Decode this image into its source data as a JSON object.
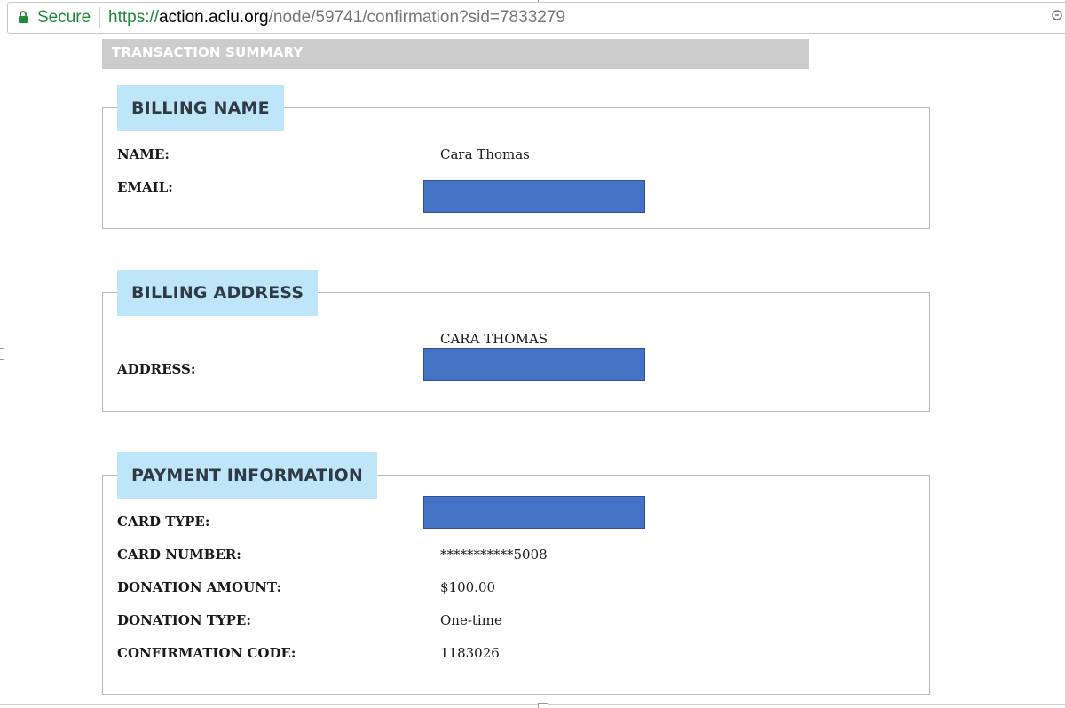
{
  "browser": {
    "secure_label": "Secure",
    "url_scheme": "https://",
    "url_host": "action.aclu.org",
    "url_path": "/node/59741/confirmation?sid=7833279",
    "secure_color": "#1e8a3c"
  },
  "summary": {
    "header": "TRANSACTION SUMMARY"
  },
  "billing_name": {
    "title": "BILLING NAME",
    "fields": [
      {
        "label": "NAME:",
        "value": "Cara Thomas"
      },
      {
        "label": "EMAIL:",
        "value": ""
      }
    ]
  },
  "billing_address": {
    "title": "BILLING ADDRESS",
    "name_line": "CARA THOMAS",
    "fields": [
      {
        "label": "ADDRESS:",
        "value": ""
      }
    ]
  },
  "payment": {
    "title": "PAYMENT INFORMATION",
    "fields": [
      {
        "label": "CARD TYPE:",
        "value": ""
      },
      {
        "label": "CARD NUMBER:",
        "value": "***********5008"
      },
      {
        "label": "DONATION AMOUNT:",
        "value": "$100.00"
      },
      {
        "label": "DONATION TYPE:",
        "value": "One-time"
      },
      {
        "label": "CONFIRMATION CODE:",
        "value": "1183026"
      }
    ]
  },
  "colors": {
    "section_title_bg": "#bfe6f8",
    "summary_header_bg": "#cccccc",
    "redaction_fill": "#4472c4"
  }
}
